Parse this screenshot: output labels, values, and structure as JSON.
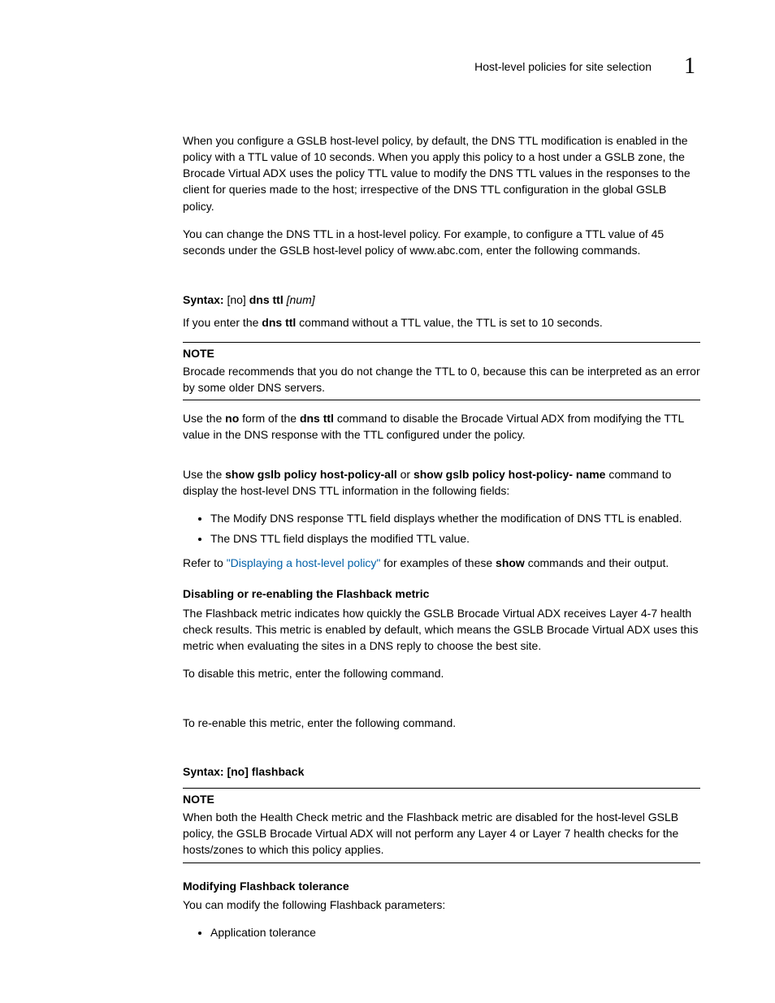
{
  "header": {
    "title": "Host-level policies for site selection",
    "chapter": "1"
  },
  "p1": "When you configure a GSLB host-level policy, by default, the DNS TTL modification is enabled in the policy with a TTL value of 10 seconds. When you apply this policy to a host under a GSLB zone, the Brocade Virtual ADX uses the policy TTL value to modify the DNS TTL values in the responses to the client for queries made to the host; irrespective of the DNS TTL configuration in the global GSLB policy.",
  "p2": "You can change the DNS TTL in a host-level policy. For example, to configure a TTL value of 45 seconds under the GSLB host-level policy of www.abc.com, enter the following commands.",
  "syntax1": {
    "label": "Syntax: ",
    "no": "[no] ",
    "cmd": "dns ttl ",
    "arg": "[num]"
  },
  "p3a": "If you enter the ",
  "p3b": "dns ttl",
  "p3c": " command without a TTL value, the TTL is set to 10 seconds.",
  "note1": {
    "label": "NOTE",
    "text": "Brocade recommends that you do not change the TTL to 0, because this can be interpreted as an error by some older DNS servers."
  },
  "p4a": "Use the ",
  "p4b": "no",
  "p4c": " form of the ",
  "p4d": "dns ttl",
  "p4e": " command to disable the Brocade Virtual ADX from modifying the TTL value in the DNS response with the TTL configured under the policy.",
  "p5a": "Use the ",
  "p5b": "show gslb policy host-policy-all",
  "p5c": " or ",
  "p5d": "show gslb policy host-policy- name",
  "p5e": " command to display the host-level DNS TTL information in the following fields:",
  "bullets1": [
    "The Modify DNS response TTL field displays whether the modification of DNS TTL is enabled.",
    "The DNS TTL field displays the modified TTL value."
  ],
  "p6a": "Refer to ",
  "p6link": "\"Displaying a host-level policy\"",
  "p6b": " for examples of these ",
  "p6c": "show",
  "p6d": " commands and their output.",
  "sub1": "Disabling or re-enabling the Flashback metric",
  "p7": "The Flashback metric indicates how quickly the GSLB Brocade Virtual ADX receives Layer 4-7 health check results. This metric is enabled by default, which means the GSLB Brocade Virtual ADX uses this metric when evaluating the sites in a DNS reply to choose the best site.",
  "p8": "To disable this metric, enter the following command.",
  "p9": "To re-enable this metric, enter the following command.",
  "syntax2": {
    "label": "Syntax: ",
    "cmd": "[no] flashback"
  },
  "note2": {
    "label": "NOTE",
    "text": "When both the Health Check metric and the Flashback metric are disabled for the host-level GSLB policy, the GSLB Brocade Virtual ADX will not perform any Layer 4 or Layer 7 health checks for the hosts/zones to which this policy applies."
  },
  "sub2": "Modifying Flashback tolerance",
  "p10": "You can modify the following Flashback parameters:",
  "bullets2": [
    "Application tolerance"
  ]
}
